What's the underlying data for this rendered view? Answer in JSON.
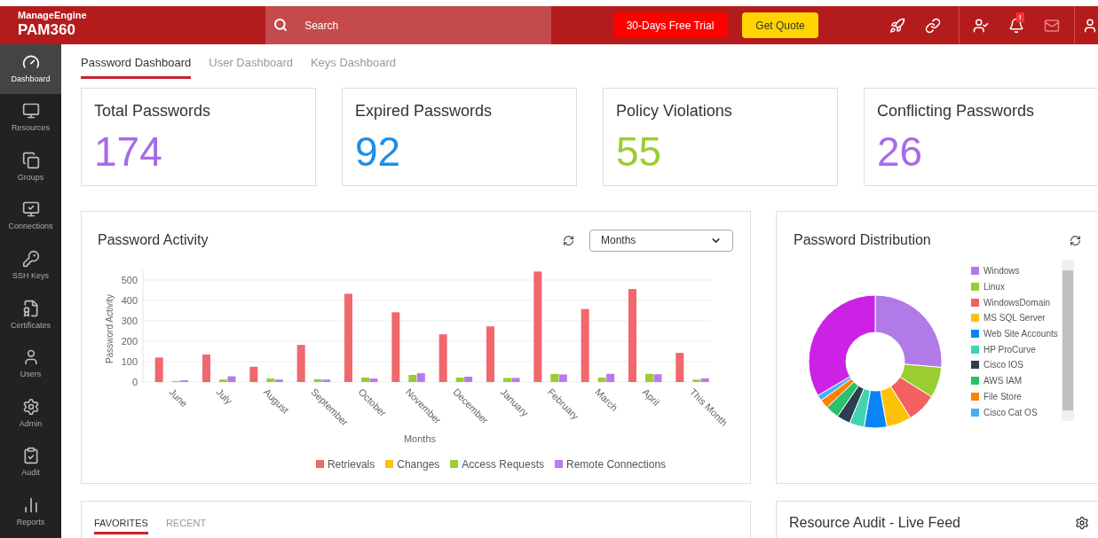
{
  "header": {
    "brand": "ManageEngine",
    "product": "PAM360",
    "search": {
      "placeholder": "Search"
    },
    "trial_button": "30-Days Free Trial",
    "quote_button": "Get Quote",
    "notification_badge": "!"
  },
  "sidebar": {
    "items": [
      {
        "label": "Dashboard",
        "selected": true
      },
      {
        "label": "Resources",
        "selected": false
      },
      {
        "label": "Groups",
        "selected": false
      },
      {
        "label": "Connections",
        "selected": false
      },
      {
        "label": "SSH Keys",
        "selected": false
      },
      {
        "label": "Certificates",
        "selected": false
      },
      {
        "label": "Users",
        "selected": false
      },
      {
        "label": "Admin",
        "selected": false
      },
      {
        "label": "Audit",
        "selected": false
      },
      {
        "label": "Reports",
        "selected": false
      }
    ]
  },
  "tabs": [
    {
      "label": "Password Dashboard",
      "selected": true
    },
    {
      "label": "User Dashboard",
      "selected": false
    },
    {
      "label": "Keys Dashboard",
      "selected": false
    }
  ],
  "stats": [
    {
      "title": "Total Passwords",
      "value": "174",
      "color": "#a66be8"
    },
    {
      "title": "Expired Passwords",
      "value": "92",
      "color": "#1e8fe6"
    },
    {
      "title": "Policy Violations",
      "value": "55",
      "color": "#9acd32"
    },
    {
      "title": "Conflicting Passwords",
      "value": "26",
      "color": "#a66be8"
    }
  ],
  "activity": {
    "title": "Password Activity",
    "period": "Months",
    "chart_data": {
      "type": "bar",
      "xlabel": "Months",
      "ylabel": "Password Activity",
      "categories": [
        "June",
        "July",
        "August",
        "September",
        "October",
        "November",
        "December",
        "January",
        "February",
        "March",
        "April",
        "This Month"
      ],
      "ylim": [
        0,
        550
      ],
      "grid": true,
      "legend": true,
      "yticks": [
        0,
        100,
        200,
        300,
        400,
        500
      ],
      "series": [
        {
          "name": "Retrievals",
          "color": "#f0686c",
          "values": [
            120,
            135,
            75,
            182,
            433,
            342,
            234,
            273,
            542,
            358,
            456,
            143
          ]
        },
        {
          "name": "Changes",
          "color": "#ffc107",
          "values": [
            0,
            0,
            0,
            0,
            0,
            0,
            0,
            0,
            0,
            0,
            0,
            0
          ]
        },
        {
          "name": "Access Requests",
          "color": "#9acd32",
          "values": [
            5,
            12,
            17,
            14,
            22,
            35,
            22,
            20,
            40,
            22,
            40,
            12
          ]
        },
        {
          "name": "Remote Connections",
          "color": "#b57bee",
          "values": [
            8,
            28,
            12,
            12,
            17,
            43,
            26,
            20,
            37,
            40,
            38,
            18
          ]
        }
      ]
    }
  },
  "distribution": {
    "title": "Password Distribution",
    "legend": [
      {
        "label": "Windows",
        "color": "#b07ae8"
      },
      {
        "label": "Linux",
        "color": "#9acd32"
      },
      {
        "label": "WindowsDomain",
        "color": "#f2605f"
      },
      {
        "label": "MS SQL Server",
        "color": "#ffc107"
      },
      {
        "label": "Web Site Accounts",
        "color": "#0a84f5"
      },
      {
        "label": "HP ProCurve",
        "color": "#40d4b0"
      },
      {
        "label": "Cisco IOS",
        "color": "#2c3e50"
      },
      {
        "label": "AWS IAM",
        "color": "#2bc06a"
      },
      {
        "label": "File Store",
        "color": "#ff8000"
      },
      {
        "label": "Cisco Cat OS",
        "color": "#45b0f5"
      }
    ]
  },
  "bottom_tabs": [
    {
      "label": "FAVORITES",
      "selected": true
    },
    {
      "label": "RECENT",
      "selected": false
    }
  ],
  "audit_feed": {
    "title": "Resource Audit - Live Feed"
  }
}
